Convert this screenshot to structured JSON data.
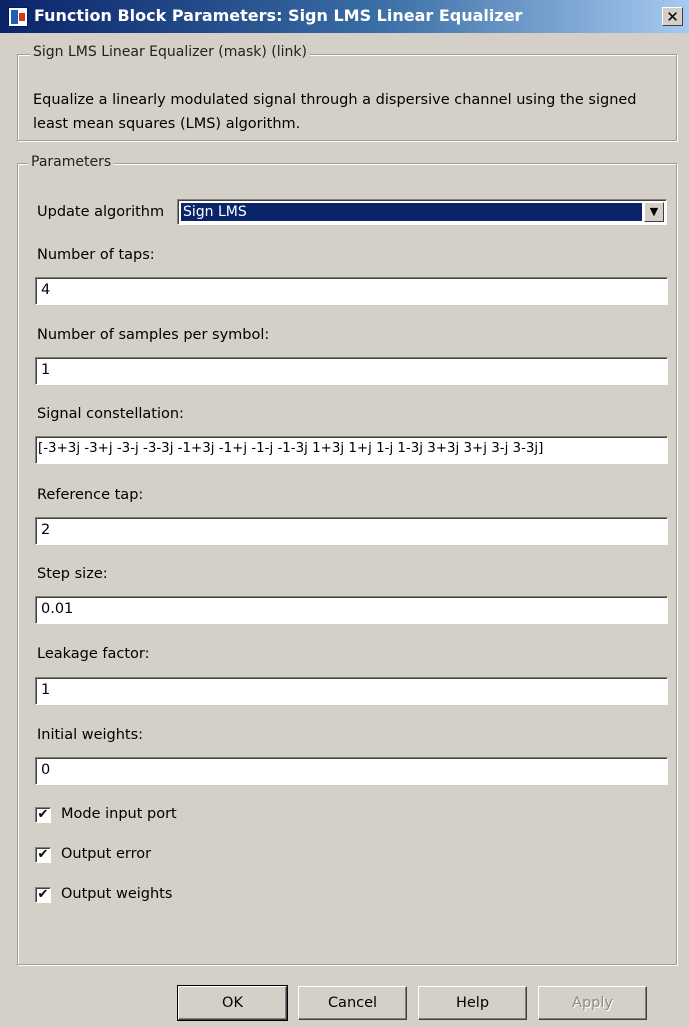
{
  "window": {
    "title": "Function Block Parameters: Sign LMS Linear Equalizer",
    "close_glyph": "✕"
  },
  "mask": {
    "group_title": "Sign LMS Linear Equalizer (mask) (link)",
    "description": "Equalize a linearly modulated signal through a dispersive channel using the signed least mean squares (LMS) algorithm."
  },
  "parameters": {
    "group_title": "Parameters",
    "update_algorithm": {
      "label": "Update algorithm",
      "value": "Sign LMS"
    },
    "num_taps": {
      "label": "Number of taps:",
      "value": "4"
    },
    "samples_per_symbol": {
      "label": "Number of samples per symbol:",
      "value": "1"
    },
    "signal_constellation": {
      "label": "Signal constellation:",
      "value": "[-3+3j -3+j -3-j -3-3j -1+3j -1+j -1-j -1-3j 1+3j 1+j 1-j 1-3j 3+3j 3+j 3-j 3-3j]"
    },
    "reference_tap": {
      "label": "Reference tap:",
      "value": "2"
    },
    "step_size": {
      "label": "Step size:",
      "value": "0.01"
    },
    "leakage_factor": {
      "label": "Leakage factor:",
      "value": "1"
    },
    "initial_weights": {
      "label": "Initial weights:",
      "value": "0"
    },
    "mode_input_port": {
      "label": "Mode input port",
      "checked": true
    },
    "output_error": {
      "label": "Output error",
      "checked": true
    },
    "output_weights": {
      "label": "Output weights",
      "checked": true
    },
    "check_glyph": "✔"
  },
  "buttons": {
    "ok": "OK",
    "cancel": "Cancel",
    "help": "Help",
    "apply": "Apply"
  }
}
